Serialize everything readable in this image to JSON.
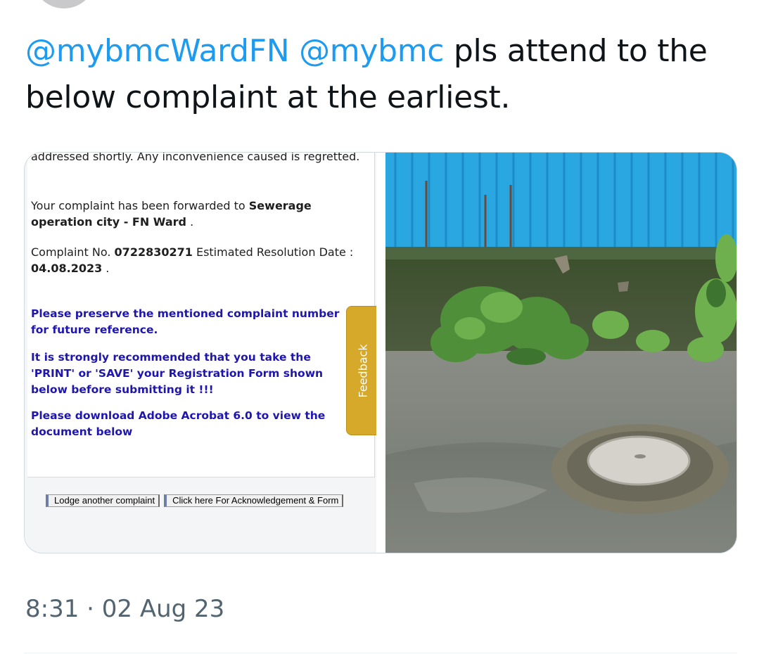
{
  "tweet": {
    "mention_1": "@mybmcWardFN",
    "mention_2": "@mybmc",
    "body": "pls attend to the below complaint at the earliest.",
    "timestamp": "8:31 · 02 Aug 23"
  },
  "screenshot": {
    "line_1": "addressed shortly. Any inconvenience caused is regretted.",
    "forwarded_prefix": "Your complaint has been forwarded to ",
    "forwarded_dept": "Sewerage operation city - FN Ward",
    "forwarded_suffix": " .",
    "complaint_label": "Complaint No. ",
    "complaint_number": "0722830271",
    "resolution_label": " Estimated Resolution Date : ",
    "resolution_date": "04.08.2023",
    "resolution_suffix": " .",
    "notice_1": "Please preserve the mentioned complaint number for future reference.",
    "notice_2": "It is strongly recommended that you take the 'PRINT' or 'SAVE' your Registration Form shown below before submitting it !!!",
    "notice_3": "Please download Adobe Acrobat 6.0 to view the document below",
    "feedback_label": "Feedback",
    "button_lodge": "Lodge another complaint",
    "button_ack": "Click here For Acknowledgement & Form"
  },
  "colors": {
    "mention": "#1d9bf0",
    "notice_blue": "#1f16b0",
    "feedback_tab": "#d6a92b",
    "fence_blue": "#2aa7e0"
  }
}
